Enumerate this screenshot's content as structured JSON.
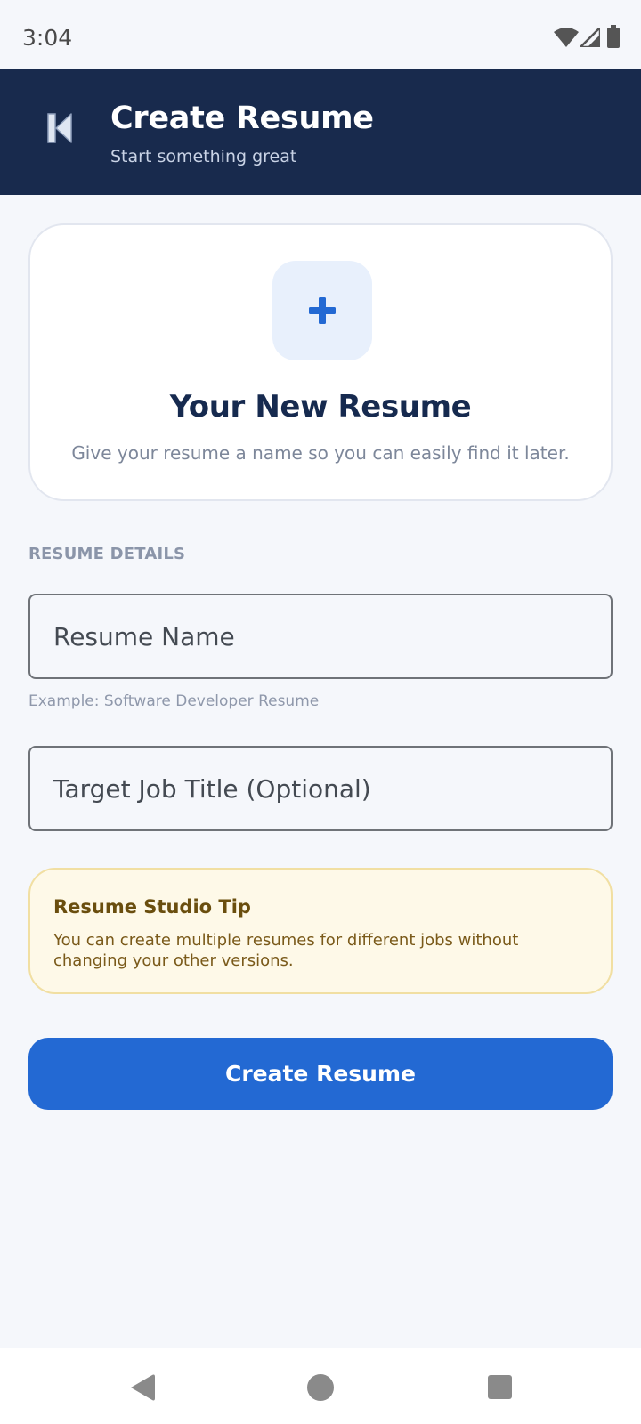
{
  "status_bar": {
    "time": "3:04",
    "icons": [
      "wifi-icon",
      "signal-icon",
      "battery-icon"
    ]
  },
  "header": {
    "back_icon": "skip-back-icon",
    "title": "Create Resume",
    "subtitle": "Start something great"
  },
  "intro_card": {
    "icon": "plus-icon",
    "title": "Your New Resume",
    "description": "Give your resume a name so you can easily find it later."
  },
  "form": {
    "section_label": "RESUME DETAILS",
    "resume_name": {
      "placeholder": "Resume Name",
      "value": "",
      "helper": "Example: Software Developer Resume"
    },
    "target_job_title": {
      "placeholder": "Target Job Title (Optional)",
      "value": ""
    }
  },
  "tip": {
    "title": "Resume Studio Tip",
    "body": "You can create multiple resumes for different jobs without changing your other versions."
  },
  "actions": {
    "create_label": "Create Resume"
  },
  "nav_bar": {
    "icons": [
      "nav-back-icon",
      "nav-home-icon",
      "nav-recents-icon"
    ]
  },
  "colors": {
    "header_bg": "#182a4d",
    "accent": "#2369d3",
    "page_bg": "#f5f7fb",
    "tip_bg": "#fef9e8",
    "tip_border": "#f1dfa2"
  }
}
